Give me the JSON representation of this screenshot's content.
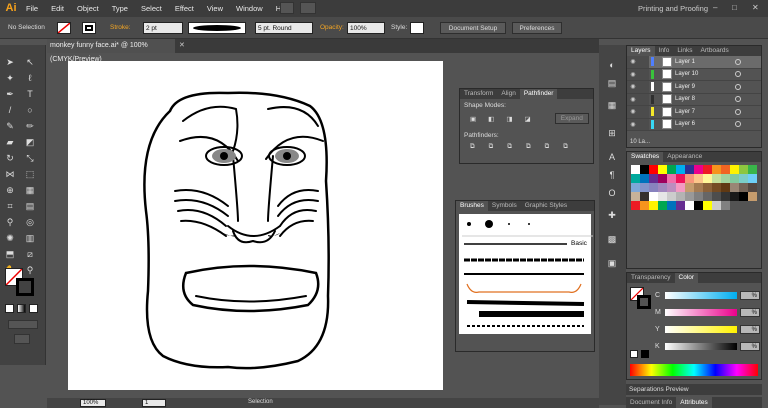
{
  "app": {
    "logo": "Ai",
    "workspace": "Printing and Proofing"
  },
  "menu": [
    "File",
    "Edit",
    "Object",
    "Type",
    "Select",
    "Effect",
    "View",
    "Window",
    "Help"
  ],
  "control": {
    "selection": "No Selection",
    "stroke_label": "Stroke:",
    "stroke_value": "2 pt",
    "brush_value": "5 pt. Round",
    "opacity_label": "Opacity:",
    "opacity_value": "100%",
    "style_label": "Style:",
    "document_setup": "Document Setup",
    "preferences": "Preferences"
  },
  "document": {
    "tab": "monkey funny face.ai* @ 100% (CMYK/Preview)",
    "zoom": "100%",
    "page": "1",
    "status": "Selection"
  },
  "pathfinder": {
    "tabs": [
      "Transform",
      "Align",
      "Pathfinder"
    ],
    "shape_modes": "Shape Modes:",
    "pathfinders": "Pathfinders:",
    "expand": "Expand"
  },
  "brushes": {
    "tabs": [
      "Brushes",
      "Symbols",
      "Graphic Styles"
    ],
    "basic": "Basic"
  },
  "layers": {
    "tabs": [
      "Layers",
      "Info",
      "Links",
      "Artboards"
    ],
    "rows": [
      {
        "name": "Layer 1",
        "color": "#4f7fff",
        "selected": true
      },
      {
        "name": "Layer 10",
        "color": "#39c23c",
        "selected": false
      },
      {
        "name": "Layer 9",
        "color": "#ffffff",
        "selected": false
      },
      {
        "name": "Layer 8",
        "color": "#2f2f2f",
        "selected": false
      },
      {
        "name": "Layer 7",
        "color": "#f6e92a",
        "selected": false
      },
      {
        "name": "Layer 6",
        "color": "#38d8f5",
        "selected": false
      }
    ],
    "footer": "10 La..."
  },
  "swatches": {
    "tabs": [
      "Swatches",
      "Appearance"
    ]
  },
  "color": {
    "tabs": [
      "Transparency",
      "Color"
    ],
    "channels": [
      "C",
      "M",
      "Y",
      "K"
    ],
    "values": [
      "%",
      "%",
      "%",
      "%"
    ]
  },
  "separations": "Separations Preview",
  "bottom": {
    "tabs": [
      "Document Info",
      "Attributes"
    ]
  }
}
